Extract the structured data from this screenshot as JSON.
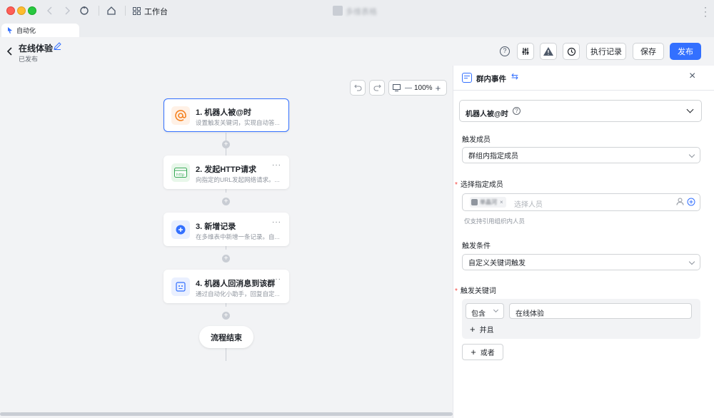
{
  "window": {
    "nav_label": "工作台",
    "doc_title": "多维表格"
  },
  "tab": {
    "label": "自动化"
  },
  "header": {
    "title": "在线体验",
    "status": "已发布",
    "btn_history": "执行记录",
    "btn_save": "保存",
    "btn_publish": "发布"
  },
  "canvas": {
    "zoom": "100%",
    "nodes": [
      {
        "title": "1. 机器人被@时",
        "desc": "设置触发关键词，实现自动答..."
      },
      {
        "title": "2. 发起HTTP请求",
        "desc": "向指定的URL发起网络请求。..."
      },
      {
        "title": "3. 新增记录",
        "desc": "在多维表中新增一条记录。自..."
      },
      {
        "title": "4. 机器人回消息到该群",
        "desc": "通过自动化小助手，回复自定..."
      }
    ],
    "more": "···",
    "end_label": "流程结束"
  },
  "panel": {
    "title": "群内事件",
    "trigger_type": "机器人被@时",
    "member_label": "触发成员",
    "member_value": "群组内指定成员",
    "select_member_label": "选择指定成员",
    "member_tag": "单晶河",
    "select_placeholder": "选择人员",
    "hint": "仅支持引用组织内人员",
    "condition_label": "触发条件",
    "condition_value": "自定义关键词触发",
    "keyword_label": "触发关键词",
    "op_value": "包含",
    "keyword_value": "在线体验",
    "and_label": "并且",
    "or_label": "或者"
  },
  "colors": {
    "accent": "#3370ff",
    "canvas_bg": "#f2f3f5"
  }
}
